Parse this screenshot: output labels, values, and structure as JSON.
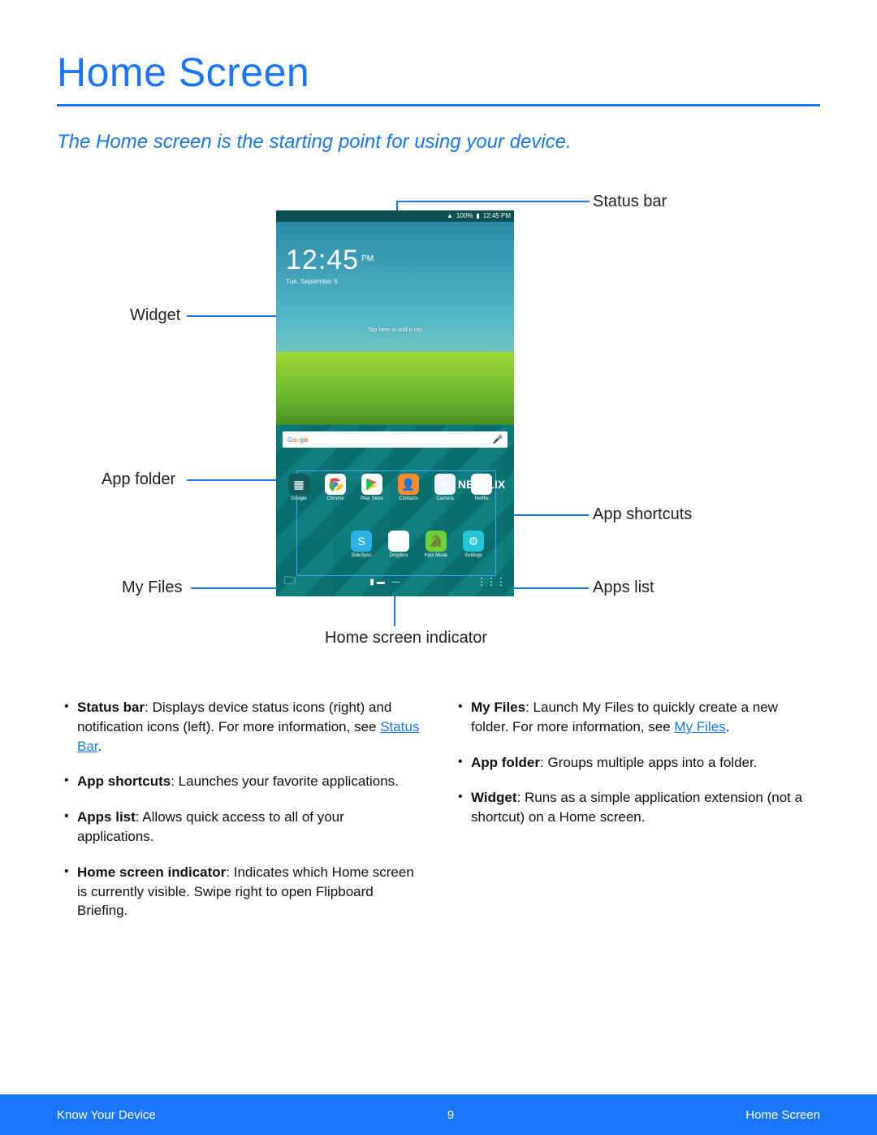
{
  "title": "Home Screen",
  "subtitle": "The Home screen is the starting point for using your device.",
  "callouts": {
    "status_bar": "Status bar",
    "widget": "Widget",
    "app_folder": "App folder",
    "my_files": "My Files",
    "app_shortcuts": "App shortcuts",
    "apps_list": "Apps list",
    "home_indicator": "Home screen indicator"
  },
  "tablet": {
    "status_battery": "100%",
    "status_time": "12:45 PM",
    "clock_time": "12:45",
    "clock_ampm": "PM",
    "clock_date": "Tue, September 6",
    "weather_hint": "Tap here to add a city",
    "search_label": "Google",
    "apps": {
      "google": "Google",
      "chrome": "Chrome",
      "play_store": "Play Store",
      "contacts": "Contacts",
      "camera": "Camera",
      "netflix": "Netflix",
      "netflix_badge": "NETFLIX",
      "sidesync": "SideSync",
      "dropbox": "Dropbox",
      "kids_mode": "Kids Mode",
      "settings": "Settings"
    }
  },
  "bullets_left": [
    {
      "term": "Status bar",
      "text": ": Displays device status icons (right) and notification icons (left). For more information, see ",
      "link": "Status Bar",
      "after": "."
    },
    {
      "term": "App shortcuts",
      "text": ": Launches your favorite applications."
    },
    {
      "term": "Apps list",
      "text": ": Allows quick access to all of your applications."
    },
    {
      "term": "Home screen indicator",
      "text": ": Indicates which Home screen is currently visible. Swipe right to open Flipboard Briefing."
    }
  ],
  "bullets_right": [
    {
      "term": "My Files",
      "text": ": Launch My Files to quickly create a new folder. For more information, see ",
      "link": "My Files",
      "after": "."
    },
    {
      "term": "App folder",
      "text": ": Groups multiple apps into a folder."
    },
    {
      "term": "Widget",
      "text": ": Runs as a simple application extension (not a shortcut) on a Home screen."
    }
  ],
  "footer": {
    "left": "Know Your Device",
    "page": "9",
    "right": "Home Screen"
  }
}
